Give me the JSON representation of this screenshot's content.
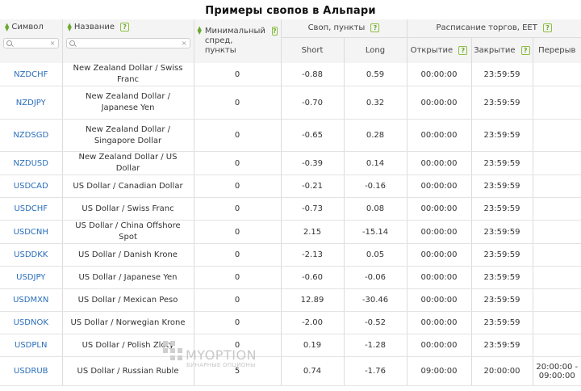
{
  "page": {
    "title": "Примеры свопов в Альпари"
  },
  "header": {
    "symbol_label": "Символ",
    "name_label": "Название",
    "min_spread_label": "Минимальный спред, пункты",
    "swap_group_label": "Своп, пункты",
    "schedule_group_label": "Расписание торгов, EET",
    "short_label": "Short",
    "long_label": "Long",
    "open_label": "Открытие",
    "close_label": "Закрытие",
    "break_label": "Перерыв",
    "help_glyph": "?",
    "clear_glyph": "×"
  },
  "rows": [
    {
      "symbol": "NZDCHF",
      "name": "New Zealand Dollar / Swiss Franc",
      "min_spread": "0",
      "short": "-0.88",
      "long": "0.59",
      "open": "00:00:00",
      "close": "23:59:59",
      "break": ""
    },
    {
      "symbol": "NZDJPY",
      "name": "New Zealand Dollar / Japanese Yen",
      "min_spread": "0",
      "short": "-0.70",
      "long": "0.32",
      "open": "00:00:00",
      "close": "23:59:59",
      "break": ""
    },
    {
      "symbol": "NZDSGD",
      "name": "New Zealand Dollar / Singapore Dollar",
      "min_spread": "0",
      "short": "-0.65",
      "long": "0.28",
      "open": "00:00:00",
      "close": "23:59:59",
      "break": ""
    },
    {
      "symbol": "NZDUSD",
      "name": "New Zealand Dollar / US Dollar",
      "min_spread": "0",
      "short": "-0.39",
      "long": "0.14",
      "open": "00:00:00",
      "close": "23:59:59",
      "break": ""
    },
    {
      "symbol": "USDCAD",
      "name": "US Dollar / Canadian Dollar",
      "min_spread": "0",
      "short": "-0.21",
      "long": "-0.16",
      "open": "00:00:00",
      "close": "23:59:59",
      "break": ""
    },
    {
      "symbol": "USDCHF",
      "name": "US Dollar / Swiss Franc",
      "min_spread": "0",
      "short": "-0.73",
      "long": "0.08",
      "open": "00:00:00",
      "close": "23:59:59",
      "break": ""
    },
    {
      "symbol": "USDCNH",
      "name": "US Dollar / China Offshore Spot",
      "min_spread": "0",
      "short": "2.15",
      "long": "-15.14",
      "open": "00:00:00",
      "close": "23:59:59",
      "break": ""
    },
    {
      "symbol": "USDDKK",
      "name": "US Dollar / Danish Krone",
      "min_spread": "0",
      "short": "-2.13",
      "long": "0.05",
      "open": "00:00:00",
      "close": "23:59:59",
      "break": ""
    },
    {
      "symbol": "USDJPY",
      "name": "US Dollar / Japanese Yen",
      "min_spread": "0",
      "short": "-0.60",
      "long": "-0.06",
      "open": "00:00:00",
      "close": "23:59:59",
      "break": ""
    },
    {
      "symbol": "USDMXN",
      "name": "US Dollar / Mexican Peso",
      "min_spread": "0",
      "short": "12.89",
      "long": "-30.46",
      "open": "00:00:00",
      "close": "23:59:59",
      "break": ""
    },
    {
      "symbol": "USDNOK",
      "name": "US Dollar / Norwegian Krone",
      "min_spread": "0",
      "short": "-2.00",
      "long": "-0.52",
      "open": "00:00:00",
      "close": "23:59:59",
      "break": ""
    },
    {
      "symbol": "USDPLN",
      "name": "US Dollar / Polish Zloty",
      "min_spread": "0",
      "short": "0.19",
      "long": "-1.28",
      "open": "00:00:00",
      "close": "23:59:59",
      "break": ""
    },
    {
      "symbol": "USDRUB",
      "name": "US Dollar / Russian Ruble",
      "min_spread": "5",
      "short": "0.74",
      "long": "-1.76",
      "open": "09:00:00",
      "close": "20:00:00",
      "break": "20:00:00 - 09:00:00"
    }
  ],
  "watermark": {
    "brand": "MYOPTION",
    "tagline": "БИНАРНЫЕ ОПЦИОНЫ"
  },
  "icons": {
    "sort": "sort-arrows-icon",
    "help": "help-icon",
    "search": "search-icon",
    "clear": "clear-icon"
  },
  "colors": {
    "accent_green": "#6aaa2a",
    "link_blue": "#2a6ebb",
    "header_bg": "#f4f4f4"
  }
}
